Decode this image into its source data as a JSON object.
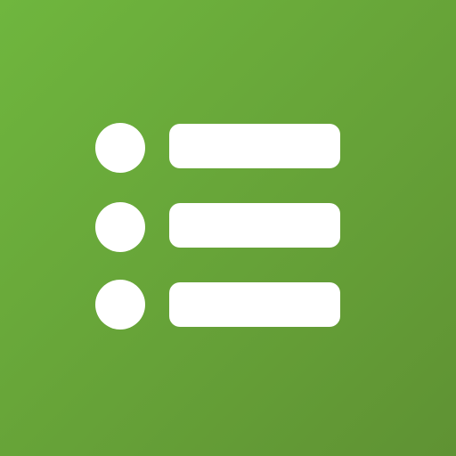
{
  "icon": {
    "name": "list-icon",
    "background_color_start": "#6fb63e",
    "background_color_end": "#5f9233",
    "glyph_color": "#ffffff",
    "rows": [
      {
        "bullet": "bullet-dot",
        "line": "list-line"
      },
      {
        "bullet": "bullet-dot",
        "line": "list-line"
      },
      {
        "bullet": "bullet-dot",
        "line": "list-line"
      }
    ]
  }
}
